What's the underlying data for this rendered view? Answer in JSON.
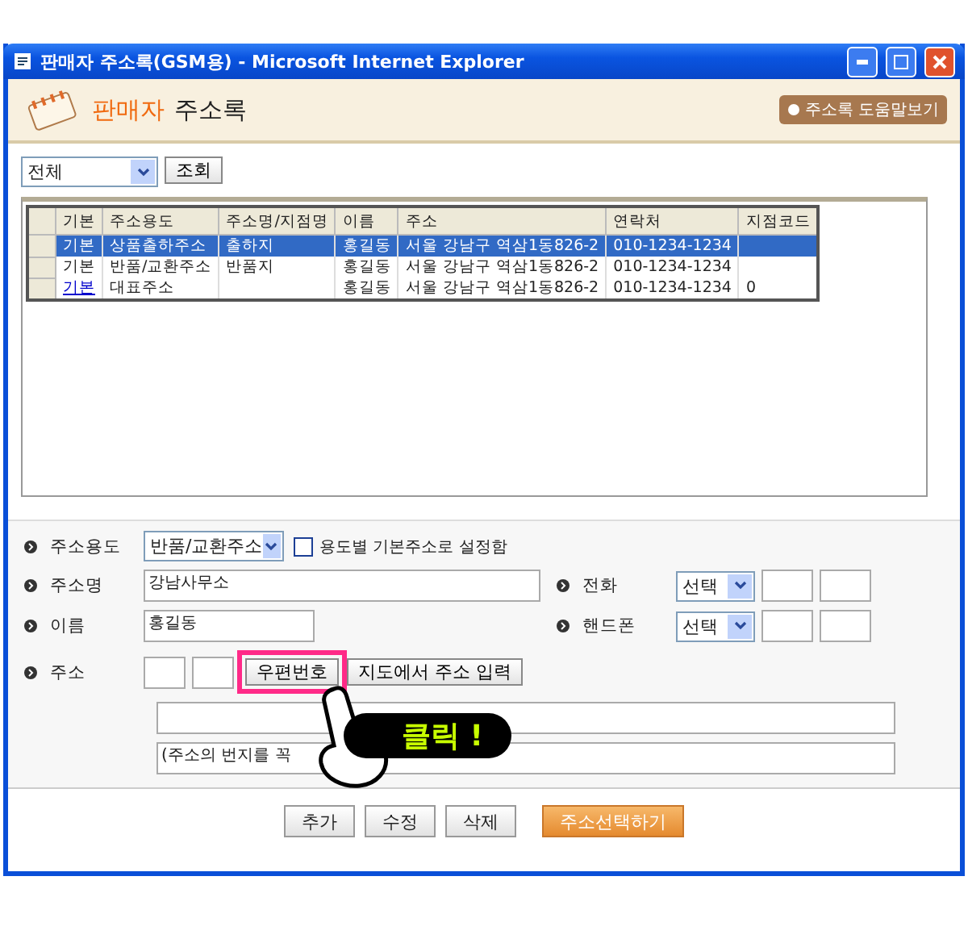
{
  "window": {
    "title": "판매자 주소록(GSM용) - Microsoft Internet Explorer"
  },
  "header": {
    "title_accent": "판매자",
    "title": "주소록",
    "help_button": "주소록 도움말보기"
  },
  "filter": {
    "value": "전체",
    "button": "조회"
  },
  "table": {
    "columns": [
      "기본",
      "주소용도",
      "주소명/지점명",
      "이름",
      "주소",
      "연락처",
      "지점코드"
    ],
    "rows": [
      {
        "selected": true,
        "linked": false,
        "cells": [
          "기본",
          "상품출하주소",
          "출하지",
          "홍길동",
          "서울 강남구 역삼1동826-2",
          "010-1234-1234",
          ""
        ]
      },
      {
        "selected": false,
        "linked": false,
        "cells": [
          "기본",
          "반품/교환주소",
          "반품지",
          "홍길동",
          "서울 강남구 역삼1동826-2",
          "010-1234-1234",
          ""
        ]
      },
      {
        "selected": false,
        "linked": true,
        "cells": [
          "기본",
          "대표주소",
          "",
          "홍길동",
          "서울 강남구 역삼1동826-2",
          "010-1234-1234",
          "0"
        ]
      }
    ]
  },
  "form": {
    "usage_label": "주소용도",
    "usage_value": "반품/교환주소",
    "default_checkbox": {
      "label": "용도별 기본주소로 설정함",
      "checked": false
    },
    "name_label": "주소명",
    "name_value": "강남사무소",
    "phone_label": "전화",
    "phone_select": "선택",
    "person_label": "이름",
    "person_value": "홍길동",
    "mobile_label": "핸드폰",
    "mobile_select": "선택",
    "address_label": "주소",
    "zip_button": "우편번호",
    "map_button": "지도에서 주소 입력",
    "detail_value": "(주소의 번지를 꼭"
  },
  "callout": {
    "text": "클릭 !"
  },
  "buttons": [
    {
      "label": "추가",
      "kind": "plain"
    },
    {
      "label": "수정",
      "kind": "plain"
    },
    {
      "label": "삭제",
      "kind": "plain"
    },
    {
      "label": "주소선택하기",
      "kind": "primary"
    }
  ]
}
